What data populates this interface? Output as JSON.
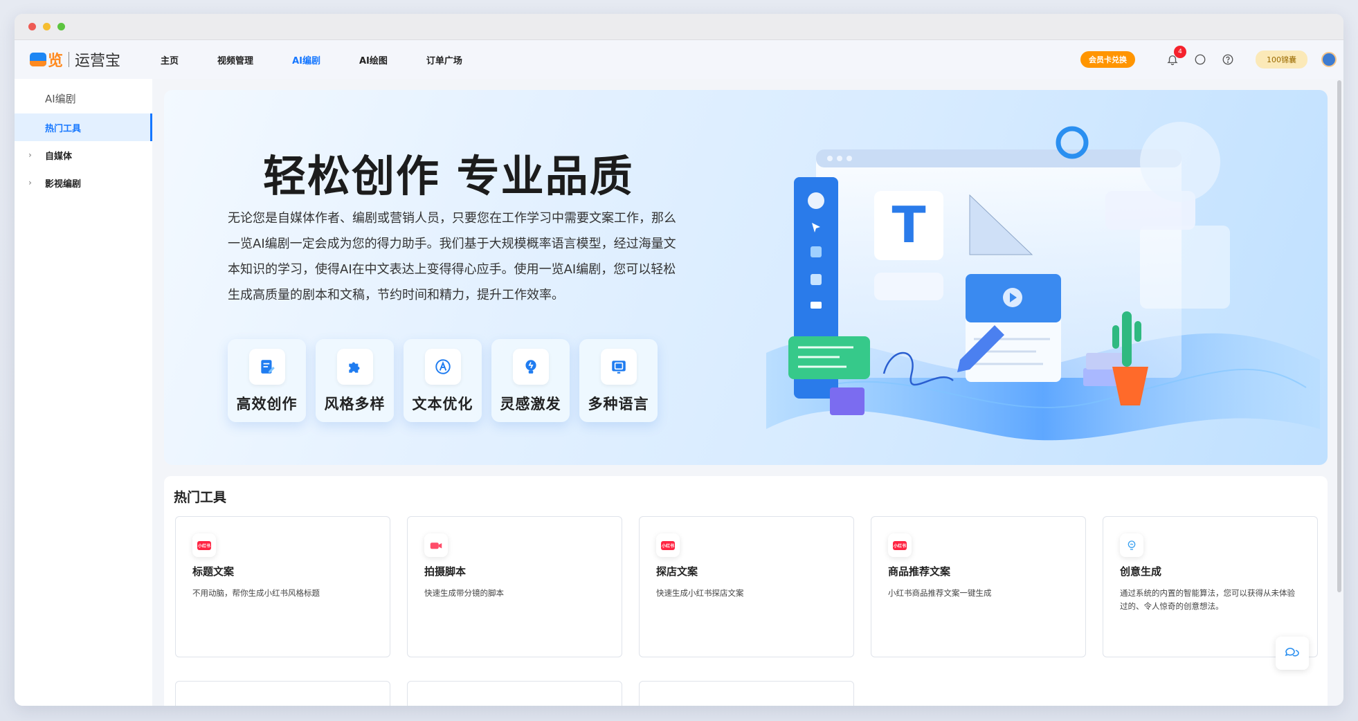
{
  "logo": {
    "mark_text": "览",
    "name": "运营宝"
  },
  "nav": {
    "items": [
      {
        "label": "主页",
        "active": false
      },
      {
        "label": "视频管理",
        "active": false
      },
      {
        "label": "AI编剧",
        "active": true
      },
      {
        "label": "AI绘图",
        "active": false
      },
      {
        "label": "订单广场",
        "active": false
      }
    ],
    "member_button": "会员卡兑换",
    "notification_count": "4",
    "coins": "100锦囊"
  },
  "sidebar": {
    "title": "AI编剧",
    "items": [
      {
        "label": "热门工具",
        "active": true,
        "expandable": false
      },
      {
        "label": "自媒体",
        "active": false,
        "expandable": true
      },
      {
        "label": "影视编剧",
        "active": false,
        "expandable": true
      }
    ]
  },
  "hero": {
    "title": "轻松创作 专业品质",
    "description": "无论您是自媒体作者、编剧或营销人员，只要您在工作学习中需要文案工作，那么一览AI编剧一定会成为您的得力助手。我们基于大规模概率语言模型，经过海量文本知识的学习，使得AI在中文表达上变得得心应手。使用一览AI编剧，您可以轻松生成高质量的剧本和文稿，节约时间和精力，提升工作效率。",
    "features": [
      {
        "label": "高效创作",
        "icon": "edit-doc-icon"
      },
      {
        "label": "风格多样",
        "icon": "puzzle-icon"
      },
      {
        "label": "文本优化",
        "icon": "text-a-icon"
      },
      {
        "label": "灵感激发",
        "icon": "bulb-icon"
      },
      {
        "label": "多种语言",
        "icon": "translate-icon"
      }
    ]
  },
  "tools": {
    "heading": "热门工具",
    "cards": [
      {
        "title": "标题文案",
        "desc": "不用动脑，帮你生成小红书风格标题",
        "icon": "xiaohongshu-icon",
        "icon_text": "小红书"
      },
      {
        "title": "拍摄脚本",
        "desc": "快速生成带分镜的脚本",
        "icon": "camera-icon",
        "icon_text": ""
      },
      {
        "title": "探店文案",
        "desc": "快速生成小红书探店文案",
        "icon": "xiaohongshu-icon",
        "icon_text": "小红书"
      },
      {
        "title": "商品推荐文案",
        "desc": "小红书商品推荐文案一键生成",
        "icon": "xiaohongshu-icon",
        "icon_text": "小红书"
      },
      {
        "title": "创意生成",
        "desc": "通过系统的内置的智能算法，您可以获得从未体验过的、令人惊奇的创意想法。",
        "icon": "idea-bulb-icon",
        "icon_text": ""
      }
    ]
  },
  "colors": {
    "accent": "#1677ff",
    "member": "#ff9500",
    "badge": "#f5222d"
  }
}
